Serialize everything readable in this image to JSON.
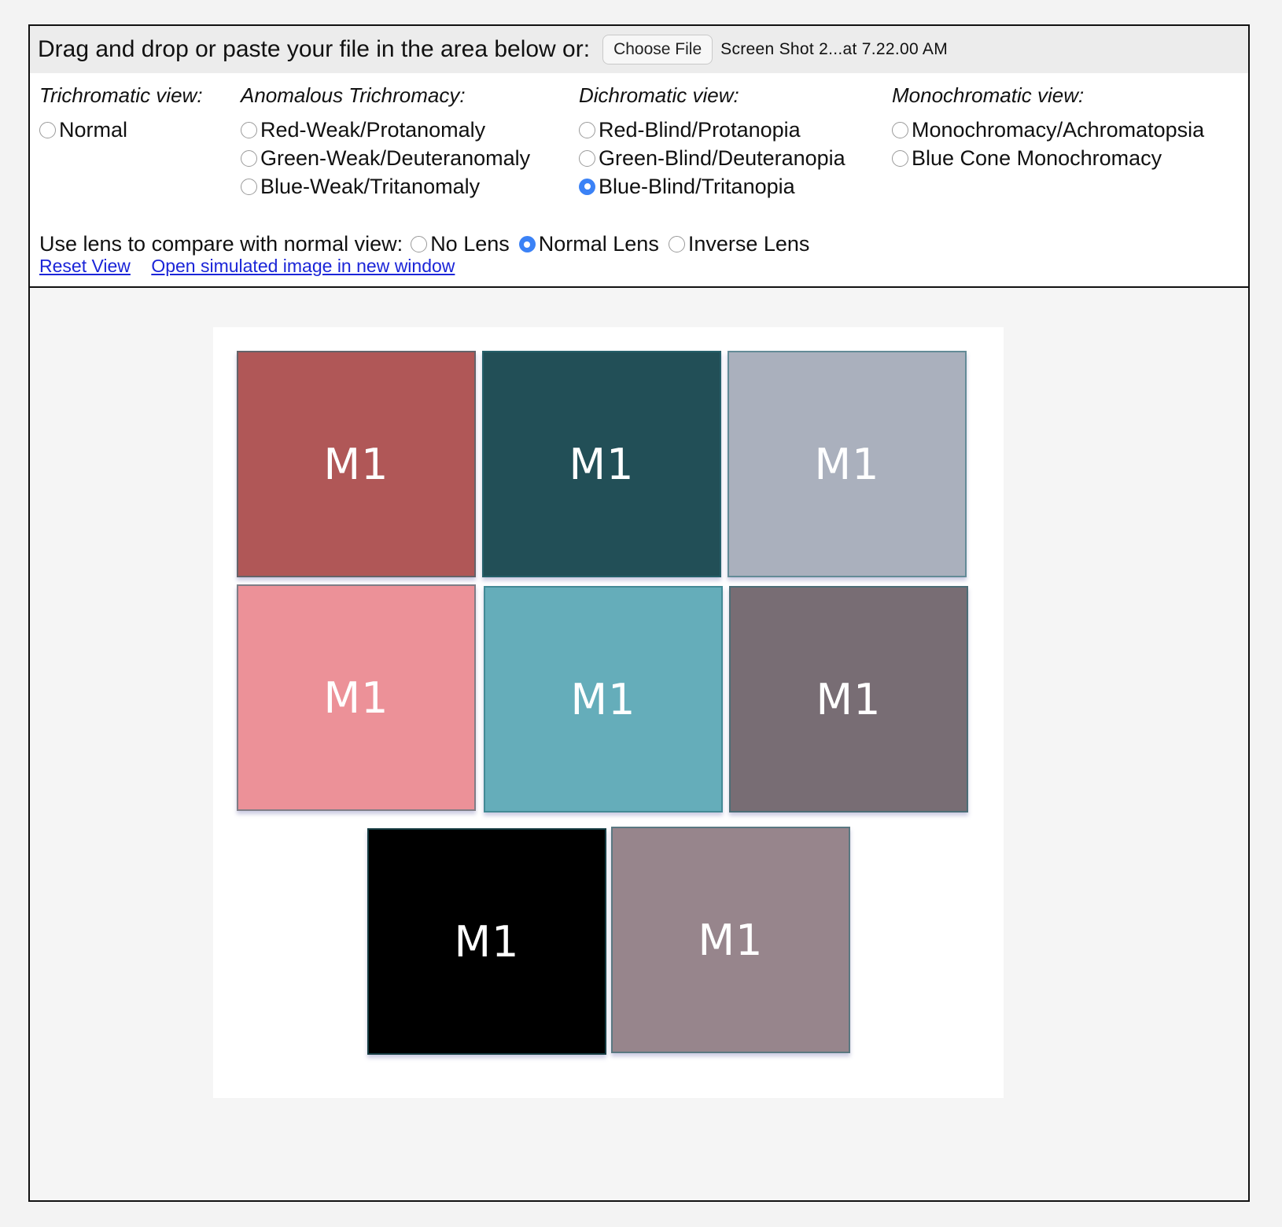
{
  "upload": {
    "label": "Drag and drop or paste your file in the area below or:",
    "choose_button": "Choose File",
    "file_name": "Screen Shot 2...at 7.22.00 AM"
  },
  "groups": [
    {
      "title": "Trichromatic view:",
      "options": [
        {
          "label": "Normal",
          "checked": false
        }
      ]
    },
    {
      "title": "Anomalous Trichromacy:",
      "options": [
        {
          "label": "Red-Weak/Protanomaly",
          "checked": false
        },
        {
          "label": "Green-Weak/Deuteranomaly",
          "checked": false
        },
        {
          "label": "Blue-Weak/Tritanomaly",
          "checked": false
        }
      ]
    },
    {
      "title": "Dichromatic view:",
      "options": [
        {
          "label": "Red-Blind/Protanopia",
          "checked": false
        },
        {
          "label": "Green-Blind/Deuteranopia",
          "checked": false
        },
        {
          "label": "Blue-Blind/Tritanopia",
          "checked": true
        }
      ]
    },
    {
      "title": "Monochromatic view:",
      "options": [
        {
          "label": "Monochromacy/Achromatopsia",
          "checked": false
        },
        {
          "label": "Blue Cone Monochromacy",
          "checked": false
        }
      ]
    }
  ],
  "lens": {
    "label": "Use lens to compare with normal view:",
    "options": [
      {
        "label": "No Lens",
        "checked": false
      },
      {
        "label": "Normal Lens",
        "checked": true
      },
      {
        "label": "Inverse Lens",
        "checked": false
      }
    ]
  },
  "links": {
    "reset": "Reset View",
    "open": "Open simulated image in new window"
  },
  "tiles": [
    {
      "label": "M1",
      "color": "#b05757"
    },
    {
      "label": "M1",
      "color": "#224f57"
    },
    {
      "label": "M1",
      "color": "#aab0bd"
    },
    {
      "label": "M1",
      "color": "#ec9198"
    },
    {
      "label": "M1",
      "color": "#65adba"
    },
    {
      "label": "M1",
      "color": "#786d74"
    },
    {
      "label": "M1",
      "color": "#000000"
    },
    {
      "label": "M1",
      "color": "#97858c"
    }
  ]
}
